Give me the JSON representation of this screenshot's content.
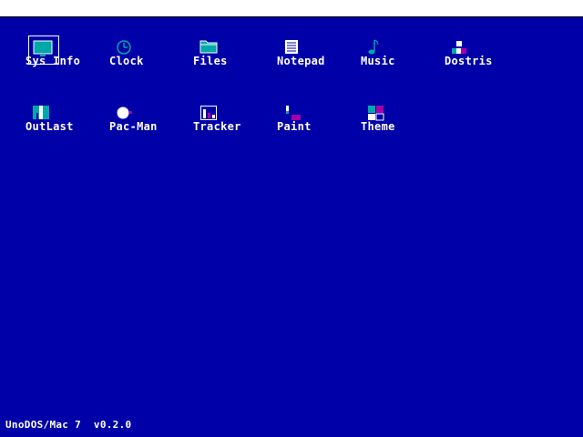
{
  "menubar": {},
  "desktop": {
    "icons": [
      {
        "label": "Sys Info",
        "icon": "monitor-icon",
        "selected": true
      },
      {
        "label": "Clock",
        "icon": "clock-icon"
      },
      {
        "label": "Files",
        "icon": "folder-icon"
      },
      {
        "label": "Notepad",
        "icon": "notepad-icon"
      },
      {
        "label": "Music",
        "icon": "music-note-icon"
      },
      {
        "label": "Dostris",
        "icon": "tetris-blocks-icon"
      },
      {
        "label": "OutLast",
        "icon": "outlast-icon"
      },
      {
        "label": "Pac-Man",
        "icon": "pacman-icon"
      },
      {
        "label": "Tracker",
        "icon": "tracker-icon"
      },
      {
        "label": "Paint",
        "icon": "paint-brush-icon"
      },
      {
        "label": "Theme",
        "icon": "theme-palette-icon"
      }
    ]
  },
  "status": {
    "version_text": "UnoDOS/Mac 7  v0.2.0"
  },
  "colors": {
    "desktop_bg": "#0000a8",
    "text": "#ffffff",
    "accent_cyan": "#00a8a8",
    "accent_magenta": "#a800a8"
  }
}
